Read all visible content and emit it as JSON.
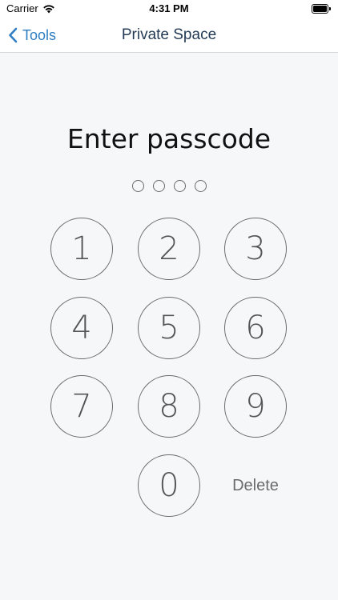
{
  "status_bar": {
    "carrier": "Carrier",
    "time": "4:31 PM",
    "wifi_icon": "wifi-icon",
    "battery_icon": "battery-full-icon"
  },
  "nav": {
    "back_label": "Tools",
    "back_icon": "chevron-left-icon",
    "title": "Private Space",
    "accent_color": "#2f7ec3"
  },
  "passcode": {
    "prompt": "Enter passcode",
    "length": 4,
    "entered": 0
  },
  "keypad": {
    "keys": [
      "1",
      "2",
      "3",
      "4",
      "5",
      "6",
      "7",
      "8",
      "9",
      "0"
    ],
    "delete_label": "Delete"
  }
}
